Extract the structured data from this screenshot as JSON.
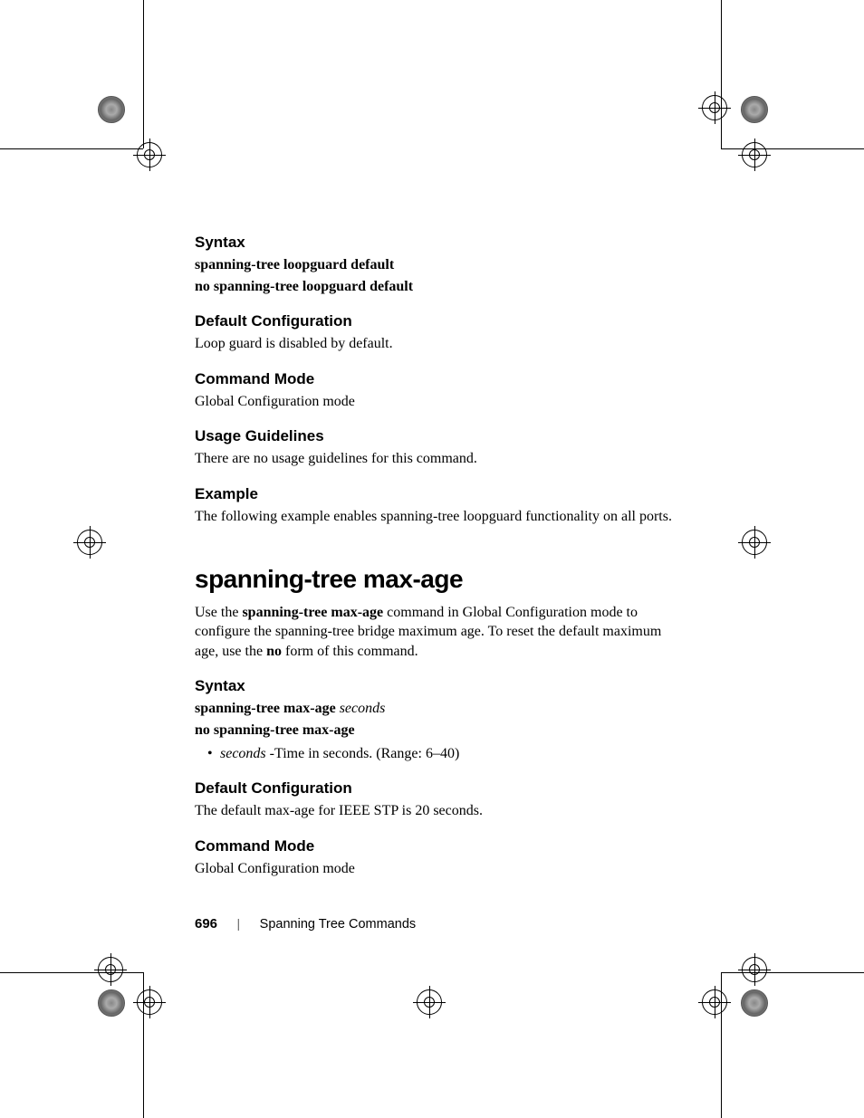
{
  "sections": {
    "syntax1": {
      "heading": "Syntax",
      "line1": "spanning-tree loopguard default",
      "line2": "no spanning-tree loopguard default"
    },
    "defconf1": {
      "heading": "Default Configuration",
      "body": "Loop guard is disabled by default."
    },
    "cmdmode1": {
      "heading": "Command Mode",
      "body": "Global Configuration mode"
    },
    "usage": {
      "heading": "Usage Guidelines",
      "body": "There are no usage guidelines for this command."
    },
    "example": {
      "heading": "Example",
      "body": "The following example enables spanning-tree loopguard functionality on all ports."
    },
    "maxage": {
      "title": "spanning-tree max-age",
      "intro_pre": "Use the ",
      "intro_bold1": "spanning-tree max-age",
      "intro_mid": " command in Global Configuration mode to configure the spanning-tree bridge maximum age. To reset the default maximum age, use the ",
      "intro_bold2": "no",
      "intro_post": " form of this command."
    },
    "syntax2": {
      "heading": "Syntax",
      "line1_bold": "spanning-tree max-age ",
      "line1_italic": "seconds",
      "line2": "no spanning-tree max-age",
      "bullet_italic": "seconds ",
      "bullet_rest": "-Time in seconds. (Range: 6–40)"
    },
    "defconf2": {
      "heading": "Default Configuration",
      "body": "The default max-age for IEEE STP is 20 seconds."
    },
    "cmdmode2": {
      "heading": "Command Mode",
      "body": "Global Configuration mode"
    }
  },
  "footer": {
    "page": "696",
    "section": "Spanning Tree Commands"
  }
}
